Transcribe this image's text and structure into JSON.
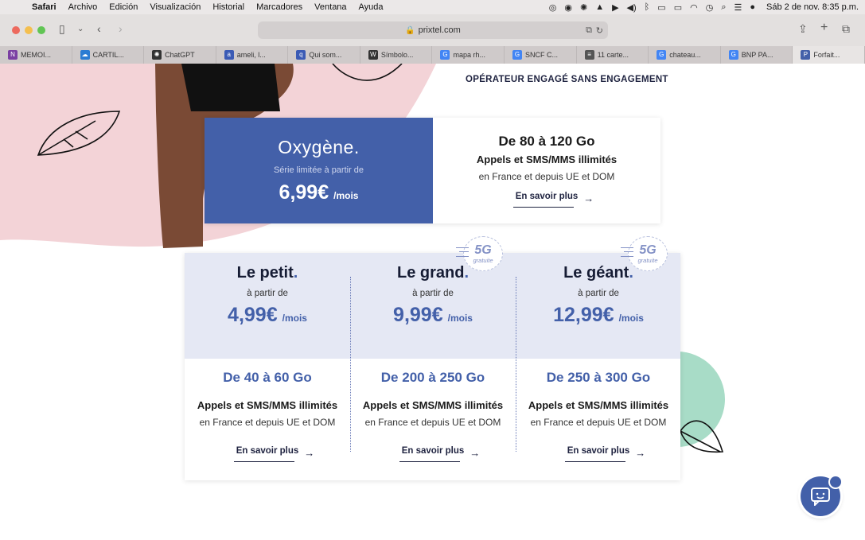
{
  "menubar": {
    "app": "Safari",
    "items": [
      "Archivo",
      "Edición",
      "Visualización",
      "Historial",
      "Marcadores",
      "Ventana",
      "Ayuda"
    ],
    "clock": "Sáb 2 de nov.  8:35 p.m."
  },
  "browser": {
    "url": "prixtel.com",
    "tabs": [
      {
        "label": "MEMOI...",
        "favicon": "onenote-icon",
        "color": "#7b3fa3"
      },
      {
        "label": "CARTIL...",
        "favicon": "onedrive-icon",
        "color": "#2b7cd3"
      },
      {
        "label": "ChatGPT",
        "favicon": "chatgpt-icon",
        "color": "#333333"
      },
      {
        "label": "ameli, l...",
        "favicon": "bookmark-icon",
        "color": "#3b5bb5"
      },
      {
        "label": "Qui som...",
        "favicon": "bookmark-icon",
        "color": "#3b5bb5"
      },
      {
        "label": "Símbolo...",
        "favicon": "wikipedia-icon",
        "color": "#333333"
      },
      {
        "label": "mapa rh...",
        "favicon": "google-icon",
        "color": "#4285f4"
      },
      {
        "label": "SNCF C...",
        "favicon": "google-icon",
        "color": "#4285f4"
      },
      {
        "label": "11 carte...",
        "favicon": "page-icon",
        "color": "#555555"
      },
      {
        "label": "chateau...",
        "favicon": "google-icon",
        "color": "#4285f4"
      },
      {
        "label": "BNP PA...",
        "favicon": "google-icon",
        "color": "#4285f4"
      },
      {
        "label": "Forfait...",
        "favicon": "prixtel-icon",
        "color": "#4360a9"
      }
    ]
  },
  "page": {
    "tagline": "OPÉRATEUR ENGAGÉ SANS ENGAGEMENT",
    "oxygene": {
      "name": "Oxygène.",
      "subtitle": "Série limitée à partir de",
      "price": "6,99€",
      "per": "/mois",
      "data": "De 80 à 120 Go",
      "calls": "Appels et SMS/MMS illimités",
      "calls_sub": "en France et depuis UE et DOM",
      "more": "En savoir plus"
    },
    "plans": [
      {
        "name": "Le petit",
        "dot": ".",
        "from": "à partir de",
        "price": "4,99€",
        "per": "/mois",
        "data": "De 40 à 60 Go",
        "calls": "Appels et SMS/MMS illimités",
        "calls_sub": "en France et depuis UE et DOM",
        "more": "En savoir plus"
      },
      {
        "name": "Le grand",
        "dot": ".",
        "from": "à partir de",
        "price": "9,99€",
        "per": "/mois",
        "data": "De 200 à 250 Go",
        "calls": "Appels et SMS/MMS illimités",
        "calls_sub": "en France et depuis UE et DOM",
        "more": "En savoir plus"
      },
      {
        "name": "Le géant",
        "dot": ".",
        "from": "à partir de",
        "price": "12,99€",
        "per": "/mois",
        "data": "De 250 à 300 Go",
        "calls": "Appels et SMS/MMS illimités",
        "calls_sub": "en France et depuis UE et DOM",
        "more": "En savoir plus"
      }
    ],
    "badge": {
      "label": "5G",
      "sub": "gratuite"
    }
  },
  "colors": {
    "brand_blue": "#4360a9",
    "pink_bg": "#f3d3d7",
    "mint": "#a8dcc7",
    "light_blue_bg": "#e5e8f4"
  }
}
